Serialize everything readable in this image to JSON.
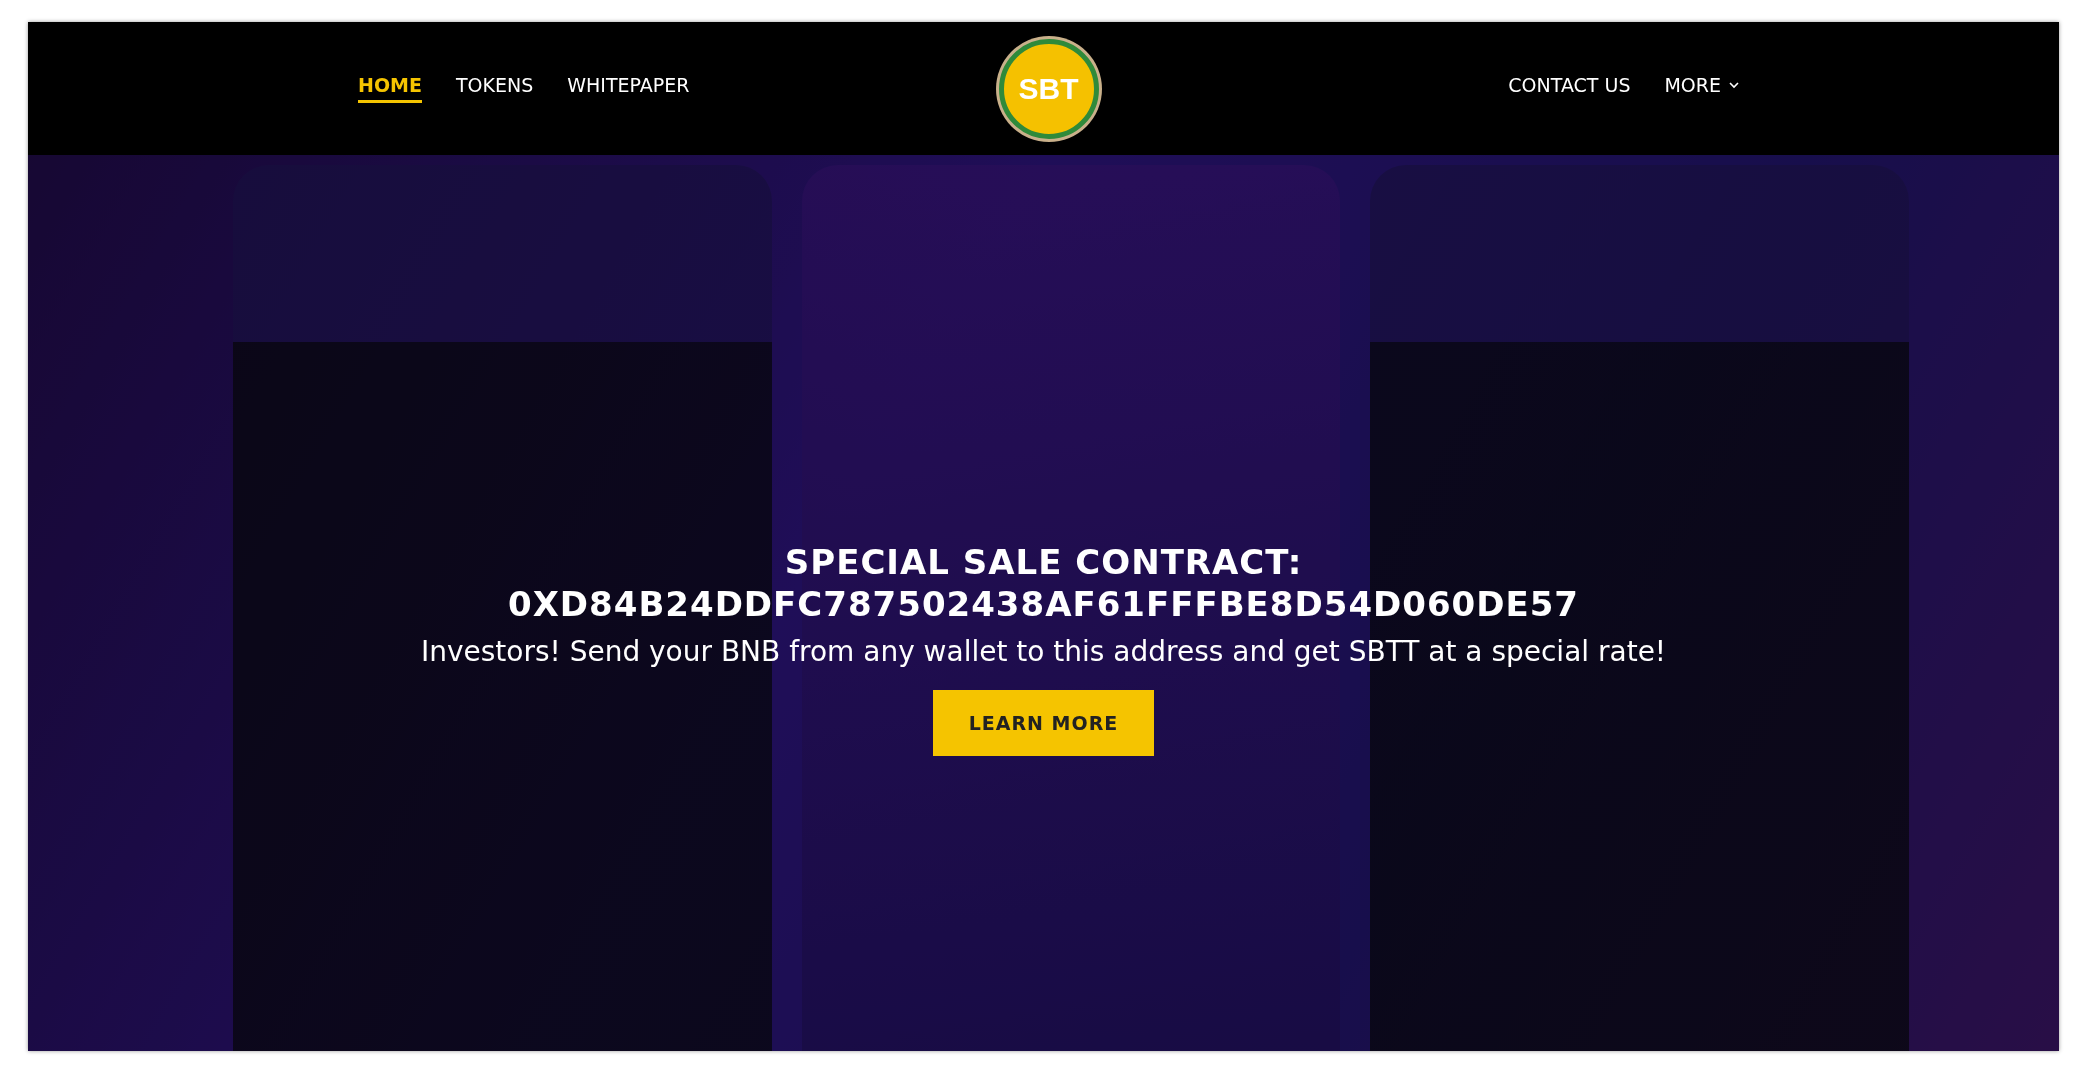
{
  "nav_left": [
    {
      "label": "HOME",
      "selected": true
    },
    {
      "label": "TOKENS",
      "selected": false
    },
    {
      "label": "WHITEPAPER",
      "selected": false
    }
  ],
  "logo": {
    "text": "SBT"
  },
  "nav_right": [
    {
      "label": "CONTACT US",
      "selected": false,
      "dropdown": false
    },
    {
      "label": "MORE",
      "selected": false,
      "dropdown": true
    }
  ],
  "hero": {
    "title": "SPECIAL SALE CONTRACT:",
    "address": "0XD84B24DDFC787502438AF61FFFBE8D54D060DE57",
    "text": "Investors! Send your BNB from any wallet to this address and get SBTT at a special rate!",
    "button": "LEARN MORE"
  }
}
